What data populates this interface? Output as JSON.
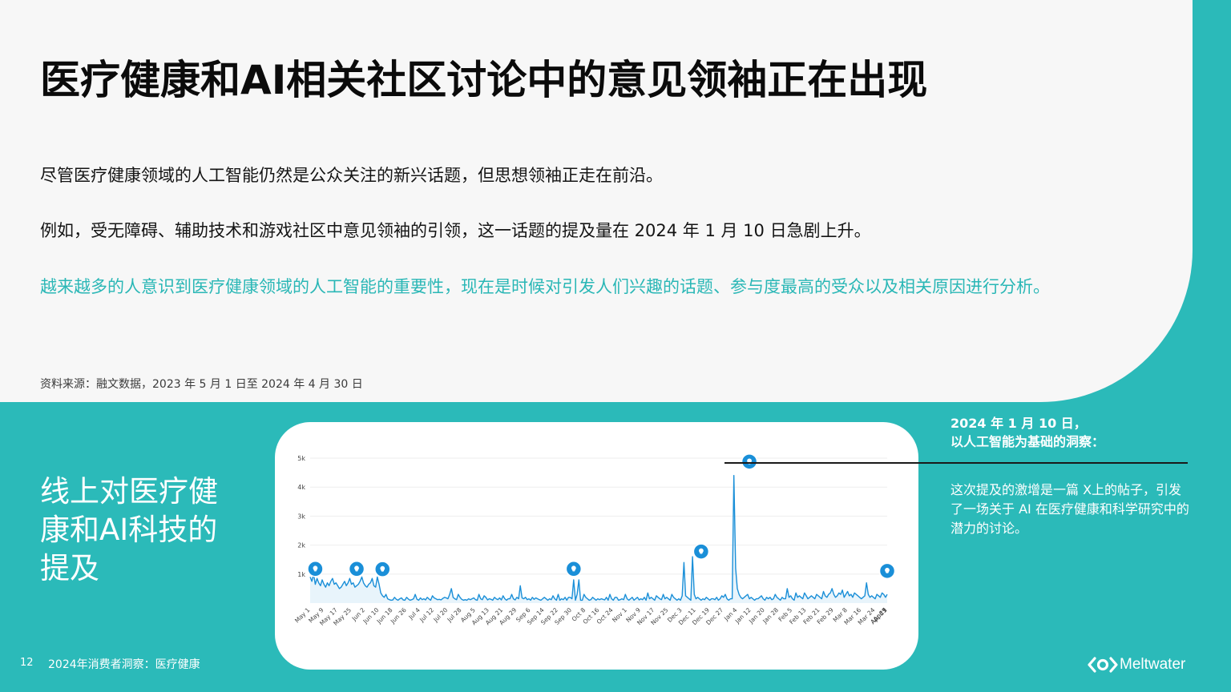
{
  "heading": "医疗健康和AI相关社区讨论中的意见领袖正在出现",
  "paragraphs": [
    "尽管医疗健康领域的人工智能仍然是公众关注的新兴话题，但思想领袖正走在前沿。",
    "例如，受无障碍、辅助技术和游戏社区中意见领袖的引领，这一话题的提及量在 2024 年 1 月 10 日急剧上升。",
    "越来越多的人意识到医疗健康领域的人工智能的重要性，现在是时候对引发人们兴趣的话题、参与度最高的受众以及相关原因进行分析。"
  ],
  "source": "资料来源：融文数据，2023 年 5 月 1 日至 2024 年 4 月 30 日",
  "left_title": "线上对医疗健康和AI科技的提及",
  "annotation": {
    "title_line1": "2024 年 1 月 10 日，",
    "title_line2": "以人工智能为基础的洞察：",
    "body": "这次提及的激增是一篇 X上的帖子，引发了一场关于 AI 在医疗健康和科学研究中的潜力的讨论。"
  },
  "footer": {
    "page_number": "12",
    "report_title": "2024年消费者洞察：医疗健康"
  },
  "brand": {
    "name": "Meltwater",
    "icon": "meltwater-logo-icon"
  },
  "colors": {
    "teal": "#2bbab9",
    "line": "#1a8fd8",
    "marker": "#1a8fd8"
  },
  "chart_data": {
    "type": "area",
    "ylim": [
      0,
      5000
    ],
    "y_ticks": [
      1000,
      2000,
      3000,
      4000,
      5000
    ],
    "y_tick_labels": [
      "1k",
      "2k",
      "3k",
      "4k",
      "5k"
    ],
    "x_tick_labels": [
      "May 1",
      "May 9",
      "May 17",
      "May 25",
      "Jun 2",
      "Jun 10",
      "Jun 18",
      "Jun 26",
      "Jul 4",
      "Jul 12",
      "Jul 20",
      "Jul 28",
      "Aug 5",
      "Aug 13",
      "Aug 21",
      "Aug 29",
      "Sep 6",
      "Sep 14",
      "Sep 22",
      "Sep 30",
      "Oct 8",
      "Oct 16",
      "Oct 24",
      "Nov 1",
      "Nov 9",
      "Nov 17",
      "Nov 25",
      "Dec 3",
      "Dec 11",
      "Dec 19",
      "Dec 27",
      "Jan 4",
      "Jan 12",
      "Jan 20",
      "Jan 28",
      "Feb 5",
      "Feb 13",
      "Feb 21",
      "Feb 29",
      "Mar 8",
      "Mar 16",
      "Mar 24",
      "Apr 1",
      "Apr 9",
      "Apr 17",
      "Apr 25"
    ],
    "start_date": "2023-05-01",
    "series": [
      {
        "values": [
          900,
          750,
          1000,
          650,
          850,
          700,
          600,
          800,
          650,
          550,
          700,
          600,
          750,
          850,
          650,
          700,
          600,
          500,
          550,
          650,
          750,
          600,
          700,
          850,
          650,
          700,
          550,
          600,
          650,
          750,
          900,
          700,
          600,
          550,
          650,
          700,
          850,
          600,
          550,
          900,
          650,
          350,
          250,
          200,
          300,
          150,
          120,
          100,
          110,
          200,
          130,
          100,
          150,
          180,
          110,
          100,
          200,
          140,
          100,
          120,
          150,
          300,
          130,
          100,
          180,
          120,
          150,
          110,
          200,
          140,
          100,
          250,
          180,
          150,
          120,
          130,
          110,
          160,
          200,
          180,
          150,
          300,
          500,
          200,
          150,
          120,
          300,
          200,
          130,
          100,
          120,
          100,
          150,
          120,
          150,
          180,
          120,
          100,
          300,
          150,
          120,
          250,
          200,
          110,
          150,
          130,
          100,
          200,
          150,
          120,
          180,
          110,
          250,
          150,
          100,
          150,
          150,
          300,
          150,
          110,
          200,
          150,
          600,
          180,
          150,
          200,
          120,
          150,
          100,
          200,
          130,
          180,
          150,
          120,
          100,
          150,
          200,
          150,
          100,
          150,
          120,
          250,
          150,
          100,
          300,
          100,
          150,
          120,
          200,
          100,
          200,
          200,
          150,
          800,
          100,
          300,
          800,
          100,
          100,
          300,
          200,
          150,
          100,
          120,
          200,
          150,
          100,
          150,
          120,
          150,
          130,
          110,
          200,
          100,
          300,
          150,
          100,
          200,
          200,
          100,
          120,
          150,
          120,
          300,
          150,
          100,
          150,
          200,
          100,
          150,
          200,
          110,
          150,
          120,
          200,
          100,
          350,
          150,
          200,
          150,
          100,
          250,
          200,
          150,
          120,
          300,
          150,
          200,
          150,
          100,
          300,
          200,
          150,
          100,
          150,
          100,
          250,
          1400,
          250,
          200,
          150,
          100,
          1600,
          300,
          150,
          200,
          150,
          100,
          150,
          120,
          200,
          150,
          100,
          150,
          150,
          120,
          200,
          100,
          150,
          250,
          200,
          300,
          150,
          100,
          150,
          150,
          4400,
          1200,
          500,
          300,
          200,
          150,
          200,
          250,
          300,
          150,
          200,
          150,
          100,
          150,
          150,
          200,
          250,
          150,
          100,
          200,
          150,
          200,
          120,
          150,
          300,
          200,
          150,
          100,
          200,
          150,
          150,
          500,
          200,
          250,
          150,
          100,
          350,
          200,
          250,
          200,
          150,
          350,
          250,
          150,
          200,
          250,
          200,
          150,
          300,
          250,
          200,
          150,
          400,
          250,
          200,
          300,
          350,
          500,
          300,
          200,
          250,
          350,
          300,
          450,
          200,
          300,
          400,
          250,
          300,
          200,
          350,
          300,
          250,
          200,
          150,
          200,
          250,
          700,
          300,
          200,
          250,
          200,
          150,
          300,
          250,
          200,
          350,
          300,
          200,
          300
        ]
      }
    ],
    "markers": [
      {
        "date": "2023-05-04",
        "value": 1180
      },
      {
        "date": "2023-05-28",
        "value": 1180
      },
      {
        "date": "2023-06-12",
        "value": 1170
      },
      {
        "date": "2023-10-01",
        "value": 1180
      },
      {
        "date": "2023-12-14",
        "value": 1780
      },
      {
        "date": "2024-01-11",
        "value": 4880
      },
      {
        "date": "2024-04-15",
        "value": 1110
      }
    ]
  }
}
